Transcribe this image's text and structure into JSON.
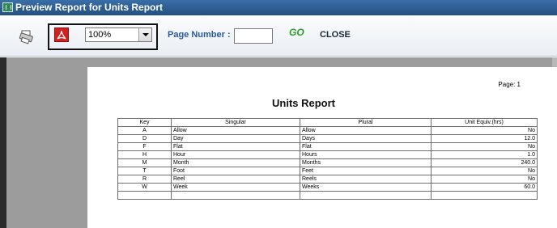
{
  "window": {
    "title": "Preview Report for Units Report"
  },
  "toolbar": {
    "print_icon": "printer-icon",
    "pdf_icon": "pdf-icon",
    "zoom": {
      "selected": "100%"
    },
    "page_number_label": "Page Number :",
    "page_number_value": "",
    "go_label": "GO",
    "close_label": "CLOSE"
  },
  "report": {
    "page_label": "Page: 1",
    "title": "Units Report",
    "columns": [
      "Key",
      "Singular",
      "Plural",
      "Unit Equiv.(hrs)"
    ],
    "rows": [
      [
        "A",
        "Allow",
        "Allow",
        "No"
      ],
      [
        "D",
        "Day",
        "Days",
        "12.0"
      ],
      [
        "F",
        "Flat",
        "Flat",
        "No"
      ],
      [
        "H",
        "Hour",
        "Hours",
        "1.0"
      ],
      [
        "M",
        "Month",
        "Months",
        "240.0"
      ],
      [
        "T",
        "Foot",
        "Feet",
        "No"
      ],
      [
        "R",
        "Reel",
        "Reels",
        "No"
      ],
      [
        "W",
        "Week",
        "Weeks",
        "60.0"
      ],
      [
        "",
        "",
        "",
        ""
      ]
    ]
  },
  "colors": {
    "titlebar": "#2b5b8f",
    "accent_label": "#2a5a9a",
    "go_green": "#2e9a2e",
    "viewer_bg": "#9c9c9c",
    "pdf_red": "#d21f1f"
  }
}
